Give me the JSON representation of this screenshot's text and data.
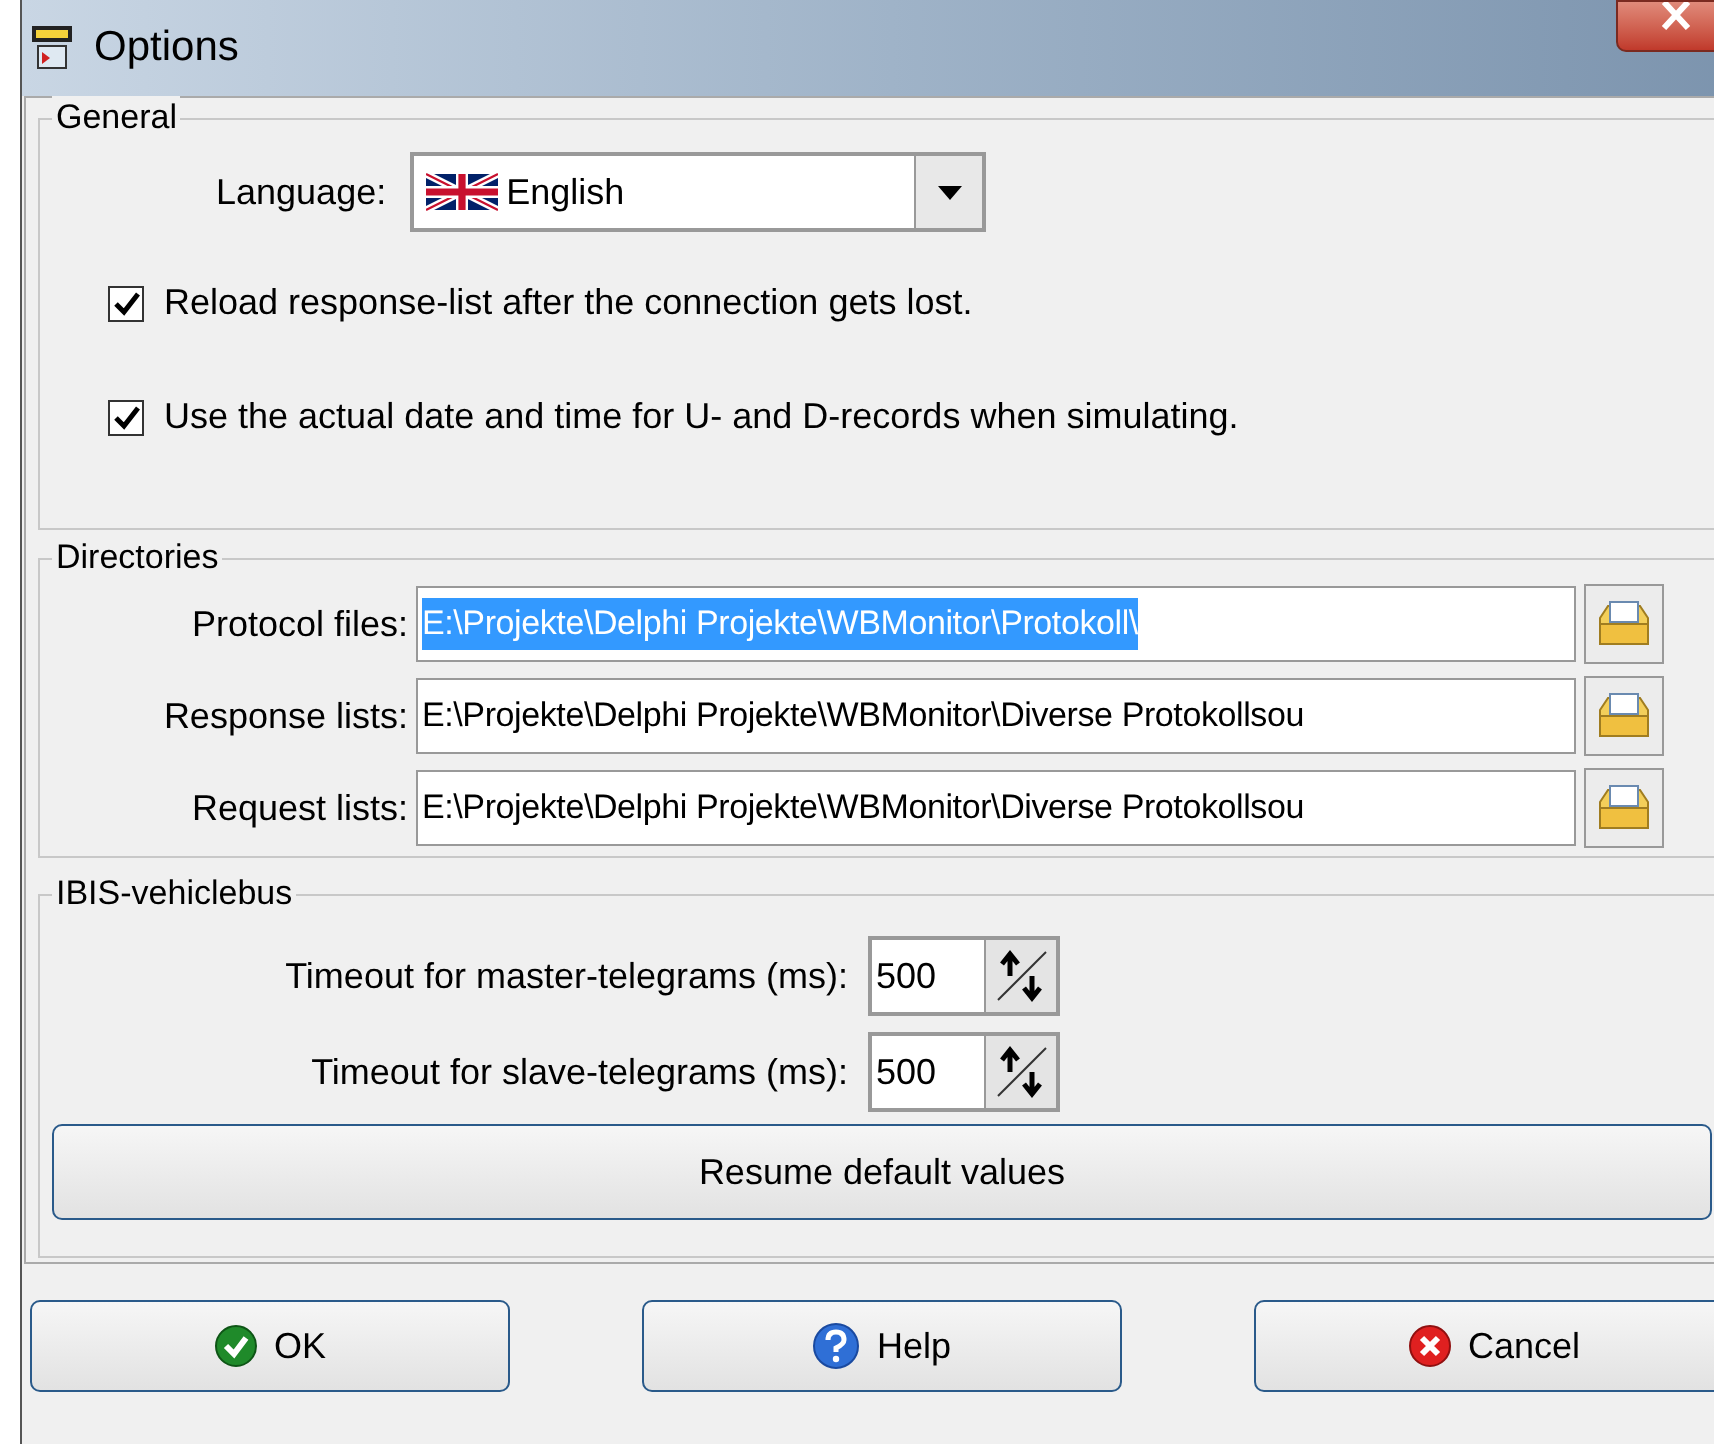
{
  "window": {
    "title": "Options"
  },
  "general": {
    "title": "General",
    "language_label": "Language:",
    "language_value": "English",
    "checkboxes": [
      {
        "label": "Reload response-list after the connection gets lost.",
        "checked": true
      },
      {
        "label": "Use the actual date and time for U- and D-records when simulating.",
        "checked": true
      }
    ]
  },
  "directories": {
    "title": "Directories",
    "rows": [
      {
        "label": "Protocol files:",
        "value": "E:\\Projekte\\Delphi Projekte\\WBMonitor\\Protokoll\\",
        "selected": true
      },
      {
        "label": "Response lists:",
        "value": "E:\\Projekte\\Delphi Projekte\\WBMonitor\\Diverse Protokollsou",
        "selected": false
      },
      {
        "label": "Request lists:",
        "value": "E:\\Projekte\\Delphi Projekte\\WBMonitor\\Diverse Protokollsou",
        "selected": false
      }
    ]
  },
  "vehiclebus": {
    "title": "IBIS-vehiclebus",
    "spinners": [
      {
        "label": "Timeout for master-telegrams (ms):",
        "value": "500"
      },
      {
        "label": "Timeout for slave-telegrams (ms):",
        "value": "500"
      }
    ],
    "reset_button": "Resume default values"
  },
  "buttons": [
    {
      "kind": "ok",
      "label": "OK"
    },
    {
      "kind": "help",
      "label": "Help"
    },
    {
      "kind": "cancel",
      "label": "Cancel"
    }
  ]
}
